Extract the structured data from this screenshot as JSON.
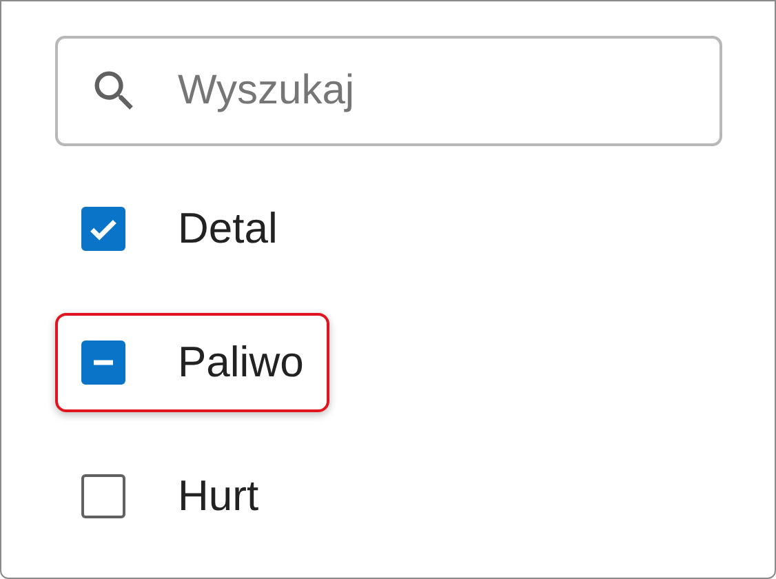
{
  "search": {
    "placeholder": "Wyszukaj"
  },
  "items": [
    {
      "label": "Detal",
      "checked": true,
      "indeterminate": false,
      "highlighted": false
    },
    {
      "label": "Paliwo",
      "checked": true,
      "indeterminate": true,
      "highlighted": true
    },
    {
      "label": "Hurt",
      "checked": false,
      "indeterminate": false,
      "highlighted": false
    }
  ]
}
